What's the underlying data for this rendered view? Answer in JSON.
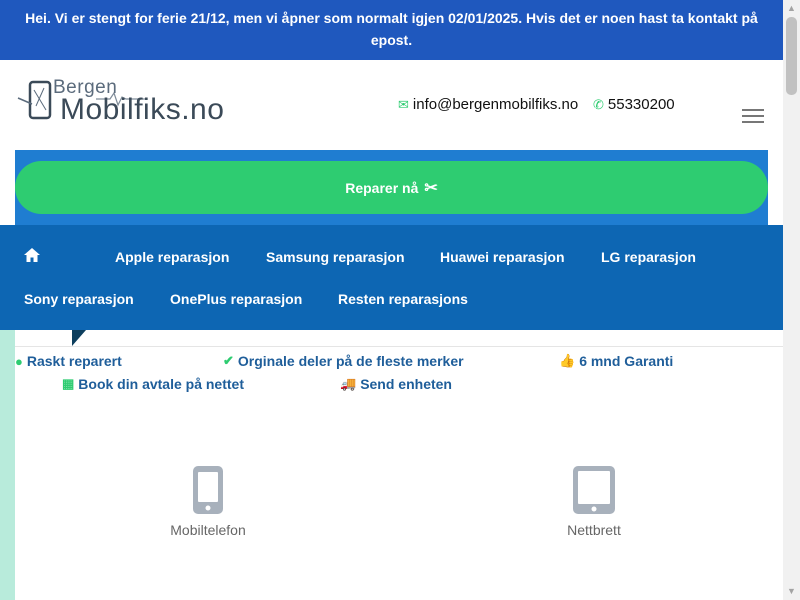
{
  "banner": {
    "text": "Hei. Vi er stengt for ferie 21/12, men vi åpner som normalt igjen 02/01/2025. Hvis det er noen hast ta kontakt på epost."
  },
  "logo": {
    "line1": "Bergen",
    "line2": "Mobilfiks.no"
  },
  "contact": {
    "email": "info@bergenmobilfiks.no",
    "phone": "55330200"
  },
  "cta": {
    "label": "Reparer nå"
  },
  "nav": {
    "items": [
      {
        "label": "Apple reparasjon"
      },
      {
        "label": "Samsung reparasjon"
      },
      {
        "label": "Huawei reparasjon"
      },
      {
        "label": "LG reparasjon"
      },
      {
        "label": "Sony reparasjon"
      },
      {
        "label": "OnePlus reparasjon"
      },
      {
        "label": "Resten reparasjons"
      }
    ]
  },
  "features": [
    {
      "label": "Raskt reparert",
      "icon": "clock-icon"
    },
    {
      "label": "Orginale deler på de fleste merker",
      "icon": "check-icon"
    },
    {
      "label": "6 mnd Garanti",
      "icon": "thumbs-up-icon"
    },
    {
      "label": "Book din avtale på nettet",
      "icon": "calendar-icon"
    },
    {
      "label": "Send enheten",
      "icon": "truck-icon"
    }
  ],
  "devices": [
    {
      "label": "Mobiltelefon",
      "icon": "mobile-phone-icon"
    },
    {
      "label": "Nettbrett",
      "icon": "tablet-icon"
    }
  ],
  "colors": {
    "banner": "#1f58be",
    "nav": "#0d66b3",
    "accent": "#2ecc71"
  }
}
